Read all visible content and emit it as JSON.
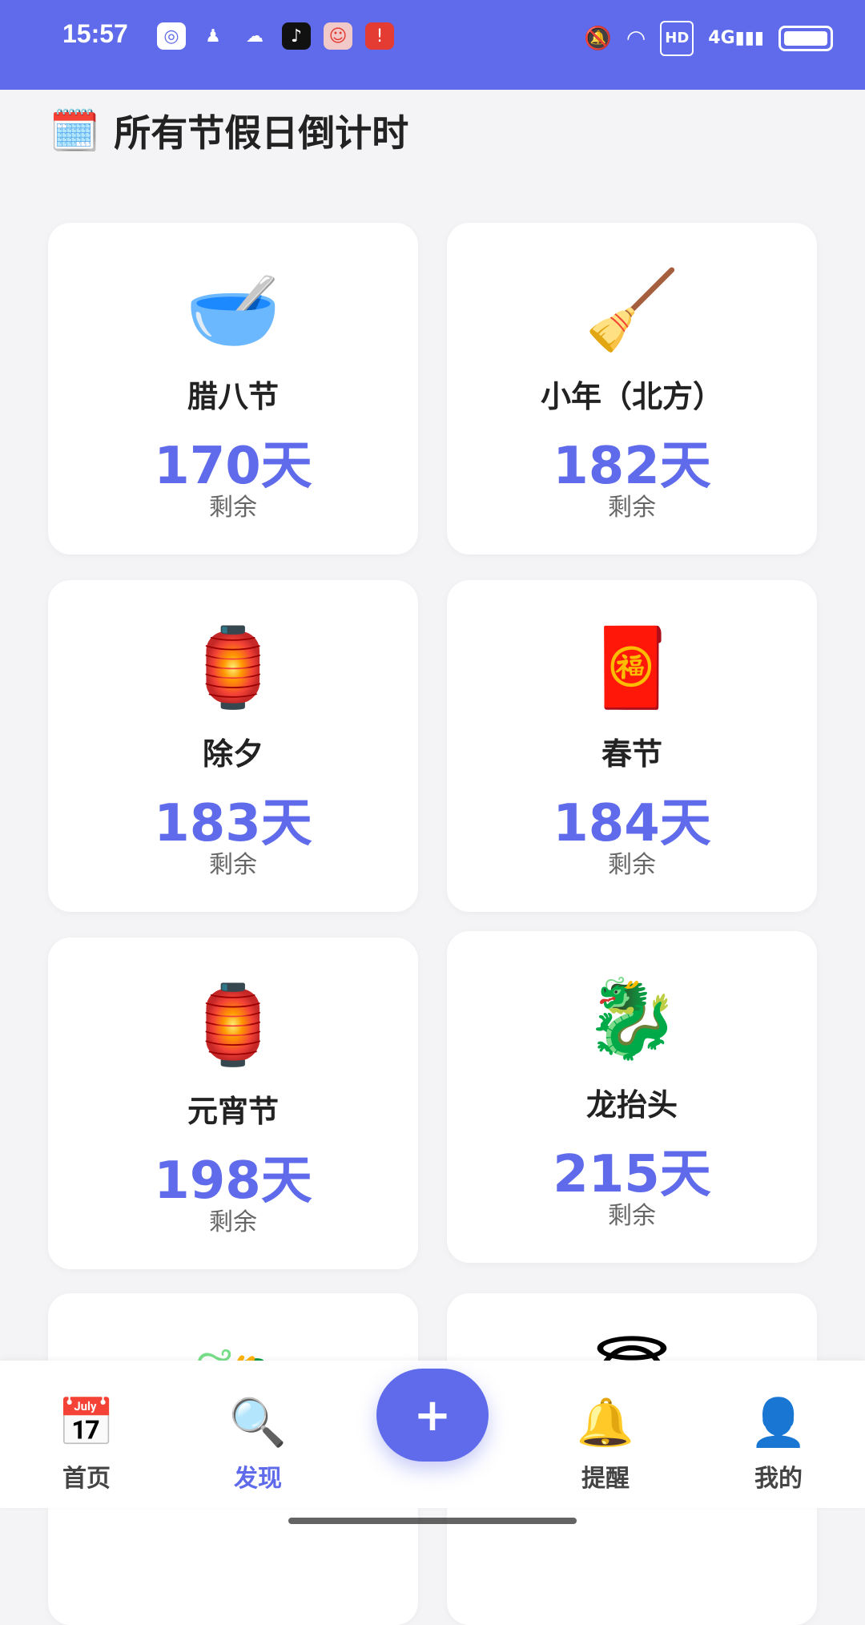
{
  "status_bar": {
    "time": "15:57",
    "network": "4G",
    "hd": "HD"
  },
  "page": {
    "title": "所有节假日倒计时",
    "title_icon": "calendar-icon"
  },
  "holidays": [
    {
      "icon": "🥣",
      "name": "腊八节",
      "days": "170天",
      "remain": "剩余"
    },
    {
      "icon": "🧹",
      "name": "小年（北方）",
      "days": "182天",
      "remain": "剩余"
    },
    {
      "icon": "🏮",
      "name": "除夕",
      "days": "183天",
      "remain": "剩余"
    },
    {
      "icon": "🧧",
      "name": "春节",
      "days": "184天",
      "remain": "剩余"
    },
    {
      "icon": "🏮",
      "name": "元宵节",
      "days": "198天",
      "remain": "剩余"
    },
    {
      "icon": "🐉",
      "name": "龙抬头",
      "days": "215天",
      "remain": "剩余"
    },
    {
      "icon": "🐲",
      "name": "",
      "days": "",
      "remain": ""
    },
    {
      "icon": "😇",
      "name": "",
      "days": "",
      "remain": ""
    }
  ],
  "bottom_nav": {
    "home": {
      "label": "首页",
      "icon": "📅"
    },
    "discover": {
      "label": "发现",
      "icon": "🔍"
    },
    "add": {
      "label": "+"
    },
    "remind": {
      "label": "提醒",
      "icon": "🔔"
    },
    "mine": {
      "label": "我的",
      "icon": "👤"
    }
  },
  "colors": {
    "accent": "#5f6bea",
    "background": "#f4f4f6"
  }
}
